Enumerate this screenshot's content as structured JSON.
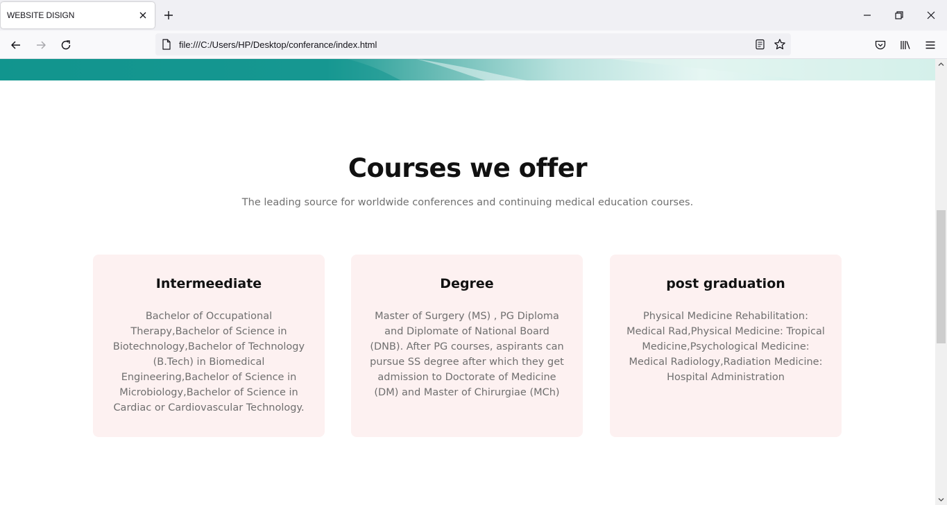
{
  "browser": {
    "tab_title": "WEBSITE DISIGN",
    "url": "file:///C:/Users/HP/Desktop/conferance/index.html"
  },
  "icons": {
    "tab_close": "close-icon",
    "new_tab": "plus-icon",
    "minimize": "minimize-icon",
    "restore": "restore-icon",
    "window_close": "close-icon",
    "back": "arrow-left-icon",
    "forward": "arrow-right-icon",
    "reload": "reload-icon",
    "page": "page-icon",
    "reader": "reader-view-icon",
    "bookmark": "star-icon",
    "pocket": "pocket-icon",
    "library": "library-icon",
    "menu": "hamburger-menu-icon"
  },
  "colors": {
    "banner_teal": "#0f948c",
    "card_bg": "#fdf1f1",
    "heading": "#111111",
    "body_text": "#6f6f6f"
  },
  "section": {
    "title": "Courses we offer",
    "subtitle": "The leading source for worldwide conferences and continuing medical education courses."
  },
  "courses": [
    {
      "title": "Intermeediate",
      "description": "Bachelor of Occupational Therapy,Bachelor of Science in Biotechnology,Bachelor of Technology (B.Tech) in Biomedical Engineering,Bachelor of Science in Microbiology,Bachelor of Science in Cardiac or Cardiovascular Technology."
    },
    {
      "title": "Degree",
      "description": "Master of Surgery (MS) , PG Diploma and Diplomate of National Board (DNB). After PG courses, aspirants can pursue SS degree after which they get admission to Doctorate of Medicine (DM) and Master of Chirurgiae (MCh)"
    },
    {
      "title": "post graduation",
      "description": "Physical Medicine Rehabilitation: Medical Rad,Physical Medicine: Tropical Medicine,Psychological Medicine: Medical Radiology,Radiation Medicine: Hospital Administration"
    }
  ]
}
